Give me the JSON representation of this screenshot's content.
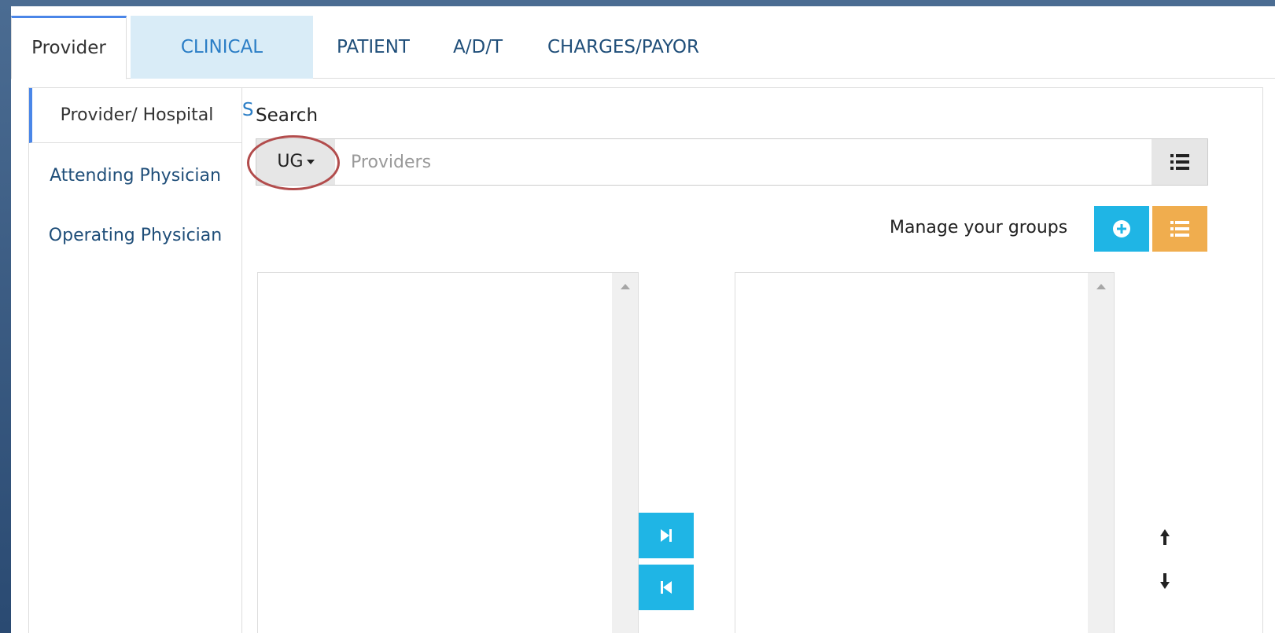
{
  "tabs": [
    {
      "label": "Provider"
    },
    {
      "label": "CLINICAL CODES"
    },
    {
      "label": "PATIENT"
    },
    {
      "label": "A/D/T"
    },
    {
      "label": "CHARGES/PAYOR"
    }
  ],
  "sidebar": {
    "items": [
      {
        "label": "Provider/ Hospital"
      },
      {
        "label": "Attending Physician"
      },
      {
        "label": "Operating Physician"
      }
    ]
  },
  "search": {
    "label": "Search",
    "scope_value": "UG",
    "placeholder": "Providers"
  },
  "groups": {
    "manage_label": "Manage your groups"
  },
  "colors": {
    "accent_blue": "#1fb5e5",
    "accent_orange": "#f0ad4e",
    "tab_active_border": "#4a86e8",
    "highlight_circle": "#b24c4c"
  },
  "icons": {
    "list_toggle": "list-icon",
    "add_group": "plus-circle-icon",
    "list_groups": "list-icon",
    "move_right": "step-forward-icon",
    "move_left": "step-backward-icon",
    "move_up": "arrow-up-icon",
    "move_down": "arrow-down-icon"
  }
}
